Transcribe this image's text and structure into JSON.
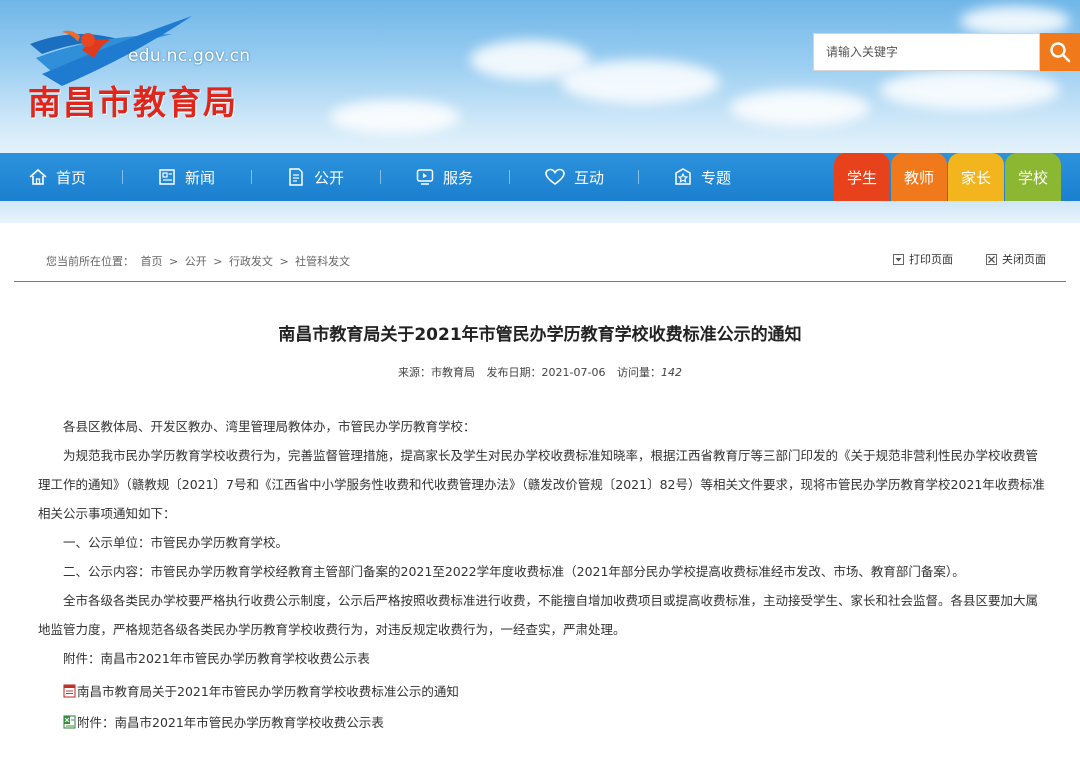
{
  "header": {
    "domain": "edu.nc.gov.cn",
    "site_name": "南昌市教育局",
    "search": {
      "placeholder": "请输入关键字"
    }
  },
  "nav": {
    "items": [
      {
        "label": "首页",
        "icon": "home-icon"
      },
      {
        "label": "新闻",
        "icon": "news-icon"
      },
      {
        "label": "公开",
        "icon": "document-icon"
      },
      {
        "label": "服务",
        "icon": "service-icon"
      },
      {
        "label": "互动",
        "icon": "heart-icon"
      },
      {
        "label": "专题",
        "icon": "topic-icon"
      }
    ],
    "roles": [
      {
        "label": "学生",
        "color": "#e8421d"
      },
      {
        "label": "教师",
        "color": "#f0791c"
      },
      {
        "label": "家长",
        "color": "#f2b51e"
      },
      {
        "label": "学校",
        "color": "#8cb733"
      }
    ]
  },
  "location": {
    "prefix": "您当前所在位置：",
    "crumbs": [
      "首页",
      ">",
      "公开",
      ">",
      "行政发文",
      ">",
      "社管科发文"
    ],
    "print_label": "打印页面",
    "close_label": "关闭页面"
  },
  "article": {
    "title": "南昌市教育局关于2021年市管民办学历教育学校收费标准公示的通知",
    "source_label": "来源：",
    "source": "市教育局",
    "date_label": "发布日期：",
    "date": "2021-07-06",
    "views_label": "访问量：",
    "views": "142",
    "salutation": "各县区教体局、开发区教办、湾里管理局教体办，市管民办学历教育学校：",
    "para1": "为规范我市民办学历教育学校收费行为，完善监督管理措施，提高家长及学生对民办学校收费标准知晓率，根据江西省教育厅等三部门印发的《关于规范非营利性民办学校收费管理工作的通知》（赣教规〔2021〕7号和《江西省中小学服务性收费和代收费管理办法》（赣发改价管规〔2021〕82号）等相关文件要求，现将市管民办学历教育学校2021年收费标准相关公示事项通知如下：",
    "item1": "一、公示单位：市管民办学历教育学校。",
    "item2": "二、公示内容：市管民办学历教育学校经教育主管部门备案的2021至2022学年度收费标准（2021年部分民办学校提高收费标准经市发改、市场、教育部门备案）。",
    "para2": "全市各级各类民办学校要严格执行收费公示制度，公示后严格按照收费标准进行收费，不能擅自增加收费项目或提高收费标准，主动接受学生、家长和社会监督。各县区要加大属地监管力度，严格规范各级各类民办学历教育学校收费行为，对违反规定收费行为，一经查实，严肃处理。",
    "attachment_note": "附件：南昌市2021年市管民办学历教育学校收费公示表",
    "file1": "南昌市教育局关于2021年市管民办学历教育学校收费标准公示的通知",
    "file2": "附件：南昌市2021年市管民办学历教育学校收费公示表"
  }
}
